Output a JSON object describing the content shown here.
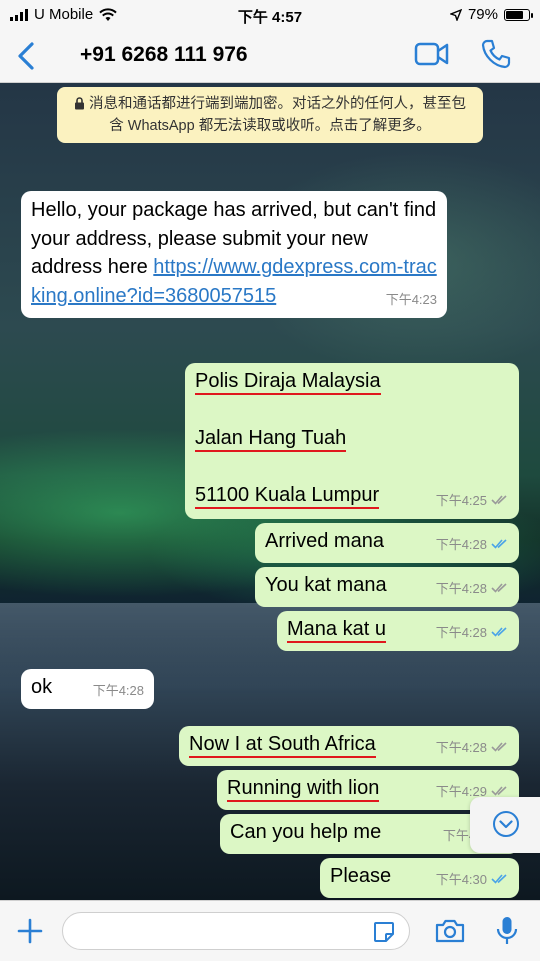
{
  "status_bar": {
    "carrier": "U Mobile",
    "time": "下午 4:57",
    "battery": "79%",
    "battery_level": 0.79
  },
  "header": {
    "contact": "+91 6268 111 976",
    "icons": [
      "chevron-left-icon",
      "video-call-icon",
      "phone-call-icon"
    ]
  },
  "encryption_notice": "消息和通话都进行端到端加密。对话之外的任何人，甚至包含 WhatsApp 都无法读取或收听。点击了解更多。",
  "messages": [
    {
      "dir": "in",
      "text": "Hello, your package has arrived, but can't find your address, please submit your new address here ",
      "link": "https://www.gdexpress.com-tracking.online?id=3680057515",
      "time": "下午4:23"
    },
    {
      "dir": "out",
      "lines": [
        "Polis Diraja Malaysia",
        "Jalan Hang Tuah",
        "51100 Kuala Lumpur"
      ],
      "time": "下午4:25",
      "status": "delivered"
    },
    {
      "dir": "out",
      "text": "Arrived mana",
      "time": "下午4:28",
      "status": "read"
    },
    {
      "dir": "out",
      "text": "You kat mana",
      "time": "下午4:28",
      "status": "delivered"
    },
    {
      "dir": "out",
      "text": "Mana kat u",
      "time": "下午4:28",
      "status": "read"
    },
    {
      "dir": "in",
      "text": "ok",
      "time": "下午4:28"
    },
    {
      "dir": "out",
      "text": "Now I at South Africa",
      "time": "下午4:28",
      "status": "delivered"
    },
    {
      "dir": "out",
      "text": "Running with lion",
      "time": "下午4:29",
      "status": "delivered"
    },
    {
      "dir": "out",
      "text": "Can you help me",
      "time": "下午4:2",
      "status": "delivered"
    },
    {
      "dir": "out",
      "text": "Please",
      "time": "下午4:30",
      "status": "read"
    }
  ],
  "colors": {
    "incoming_bubble": "#ffffff",
    "outgoing_bubble": "#dcf7c5",
    "read_tick": "#4aa3e8",
    "delivered_tick": "#9a9a9a",
    "link": "#2a78c6",
    "annotation_underline": "#e0181e",
    "notice_bg": "#fbf2c0"
  },
  "composer": {
    "placeholder": "",
    "icons": [
      "plus-icon",
      "sticker-icon",
      "camera-icon",
      "microphone-icon"
    ]
  }
}
